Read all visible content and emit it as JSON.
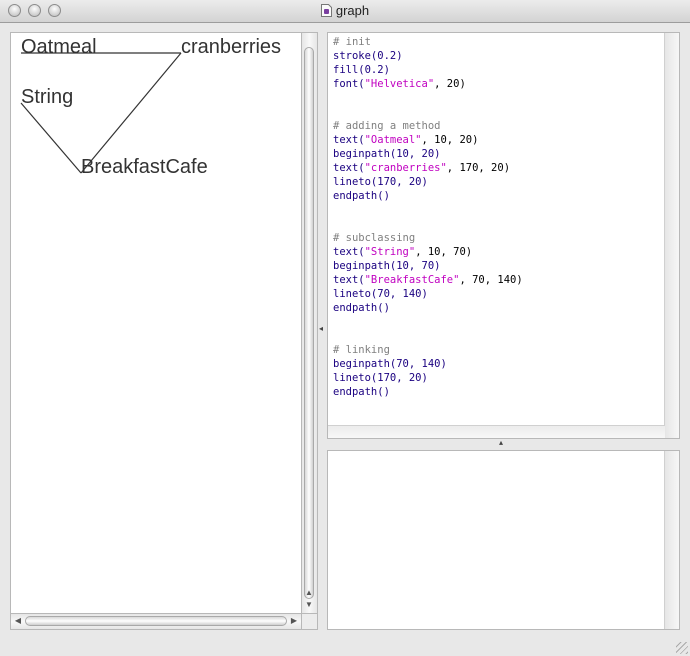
{
  "window": {
    "title": "graph",
    "title_icon": "python-document-icon"
  },
  "canvas": {
    "texts": {
      "oatmeal": "Oatmeal",
      "cranberries": "cranberries",
      "string": "String",
      "breakfastcafe": "BreakfastCafe"
    },
    "stroke": "#333333",
    "fill": "#333333"
  },
  "code": {
    "comment_init": "# init",
    "l_stroke": "stroke(0.2)",
    "l_fill": "fill(0.2)",
    "l_font_fn": "font(",
    "l_font_str": "\"Helvetica\"",
    "l_font_rest": ", 20)",
    "comment_method": "# adding a method",
    "l_text1_fn": "text(",
    "l_text1_str": "\"Oatmeal\"",
    "l_text1_rest": ", 10, 20)",
    "l_begin1": "beginpath(10, 20)",
    "l_text2_fn": "text(",
    "l_text2_str": "\"cranberries\"",
    "l_text2_rest": ", 170, 20)",
    "l_line1": "lineto(170, 20)",
    "l_end1": "endpath()",
    "comment_subclass": "# subclassing",
    "l_text3_fn": "text(",
    "l_text3_str": "\"String\"",
    "l_text3_rest": ", 10, 70)",
    "l_begin2": "beginpath(10, 70)",
    "l_text4_fn": "text(",
    "l_text4_str": "\"BreakfastCafe\"",
    "l_text4_rest": ", 70, 140)",
    "l_line2": "lineto(70, 140)",
    "l_end2": "endpath()",
    "comment_link": "# linking",
    "l_begin3": "beginpath(70, 140)",
    "l_line3": "lineto(170, 20)",
    "l_end3": "endpath()"
  },
  "colors": {
    "comment": "#808080",
    "function": "#1a0080",
    "string": "#c000c0"
  }
}
